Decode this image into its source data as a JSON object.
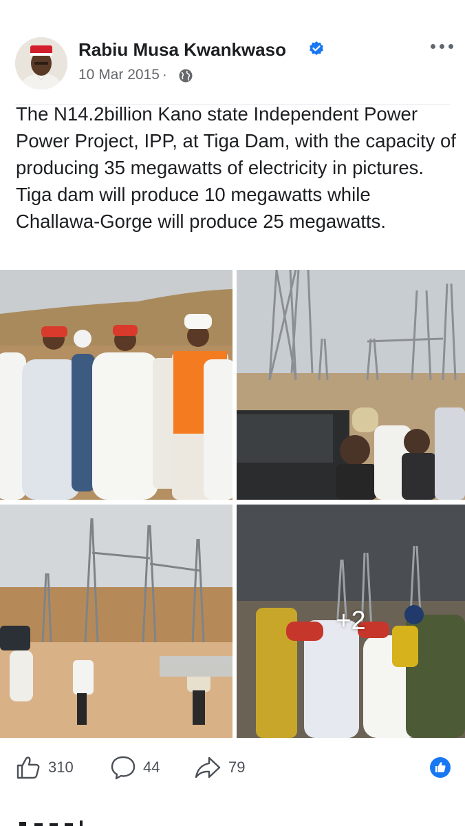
{
  "post": {
    "author": "Rabiu Musa Kwankwaso",
    "date": "10 Mar 2015",
    "separator": "·",
    "text": "The N14.2billion Kano state Independent Power Power Project, IPP, at Tiga Dam, with the capacity of producing 35 megawatts of electricity in pictures. Tiga dam will produce 10 megawatts while Challawa-Gorge will produce 25 megawatts.",
    "more_photos_label": "+2"
  },
  "reactions": {
    "likes": "310",
    "comments": "44",
    "shares": "79"
  },
  "icons": {
    "verified": "verified-badge-icon",
    "audience": "globe-icon",
    "menu": "more-options-icon",
    "like": "thumbs-up-icon",
    "comment": "comment-bubble-icon",
    "share": "share-arrow-icon",
    "like_reaction": "like-reaction-icon"
  },
  "colors": {
    "verified_blue": "#1877f2",
    "text": "#1c1e21",
    "secondary_text": "#65676b"
  }
}
